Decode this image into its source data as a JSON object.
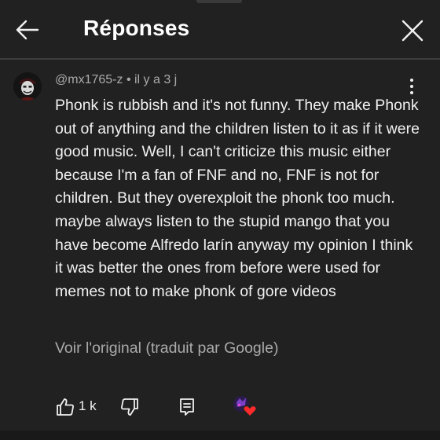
{
  "header": {
    "title": "Réponses",
    "back_icon": "arrow-left-icon",
    "close_icon": "close-icon"
  },
  "comment": {
    "author": "@mx1765-z",
    "separator": "•",
    "time": "il y a 3 j",
    "meta_text": "@mx1765-z • il y a 3 j",
    "text": "Phonk is rubbish and it's not funny. They make Phonk out of anything and the children listen to it as if it were good music. Well, I can't criticize this music either because I'm a fan of FNF and no, FNF is not for children. But they overexploit the phonk too much. maybe always listen to the stupid mango that you have become Alfredo larín anyway my opinion I think it was better the ones from before were used for memes not to make phonk of gore videos",
    "translate_link": "Voir l'original (traduit par Google)"
  },
  "actions": {
    "like_count": "1 k",
    "like_icon": "thumb-up-icon",
    "dislike_icon": "thumb-down-icon",
    "reply_icon": "reply-comment-icon",
    "creator_heart_icon": "creator-heart-icon"
  },
  "colors": {
    "background": "#212121",
    "text": "#f1f1f1",
    "secondary_text": "#aaaaaa",
    "heart": "#ff2a2a"
  }
}
